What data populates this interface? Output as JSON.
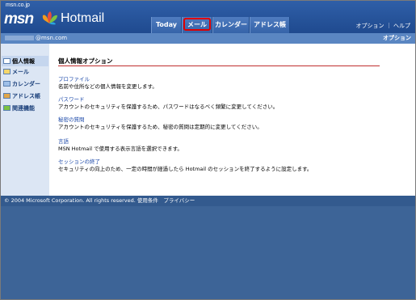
{
  "header": {
    "site_label": "msn.co.jp",
    "logo_text": "msn",
    "product_name": "Hotmail",
    "tabs": [
      {
        "label": "Today"
      },
      {
        "label": "メール"
      },
      {
        "label": "カレンダー"
      },
      {
        "label": "アドレス帳"
      }
    ],
    "top_links": "オプション ｜ ヘルプ"
  },
  "user_bar": {
    "email_suffix": "@msn.com",
    "section_title": "オプション"
  },
  "sidebar": {
    "items": [
      {
        "label": "個人情報"
      },
      {
        "label": "メール"
      },
      {
        "label": "カレンダー"
      },
      {
        "label": "アドレス帳"
      },
      {
        "label": "関連機能"
      }
    ]
  },
  "main": {
    "title": "個人情報オプション",
    "options": [
      {
        "link": "プロファイル",
        "description": "名前や住所などの個人情報を変更します。"
      },
      {
        "link": "パスワード",
        "description": "アカウントのセキュリティを保護するため、パスワードはなるべく頻繁に変更してください。"
      },
      {
        "link": "秘密の質問",
        "description": "アカウントのセキュリティを保護するため、秘密の質問は定期的に変更してください。"
      },
      {
        "link": "言語",
        "description": "MSN Hotmail で使用する表示言語を選択できます。"
      },
      {
        "link": "セッションの終了",
        "description": "セキュリティの向上のため、一定の時間が経過したら Hotmail のセッションを終了するように設定します。"
      }
    ]
  },
  "footer": {
    "text": "© 2004 Microsoft Corporation. All rights reserved. 使用条件　プライバシー"
  },
  "colors": {
    "header_blue": "#1f4a8f",
    "page_background": "#3d6497",
    "highlight_red": "#e00000",
    "link_blue": "#1a47a8"
  }
}
